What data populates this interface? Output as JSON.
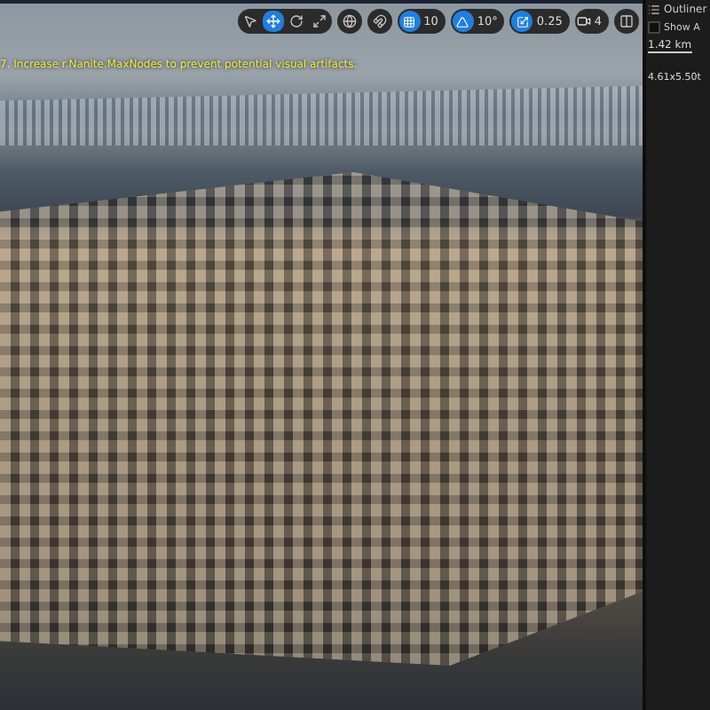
{
  "viewport": {
    "message": "7. Increase r.Nanite.MaxNodes to prevent potential visual artifacts.",
    "toolbar": {
      "transform_tools": [
        {
          "kind": "select",
          "selected": false
        },
        {
          "kind": "translate",
          "selected": true
        },
        {
          "kind": "rotate",
          "selected": false
        },
        {
          "kind": "scale",
          "selected": false
        }
      ],
      "snaps": [
        {
          "kind": "grid",
          "selected": true,
          "value": "10"
        },
        {
          "kind": "angle",
          "selected": true,
          "value": "10°"
        },
        {
          "kind": "scale",
          "selected": true,
          "value": "0.25"
        }
      ],
      "camera_speed": "4"
    }
  },
  "outliner": {
    "title": "Outliner",
    "checkbox": {
      "label": "Show A",
      "checked": false
    },
    "distance": "1.42 km",
    "dimensions": "4.61x5.50t"
  }
}
